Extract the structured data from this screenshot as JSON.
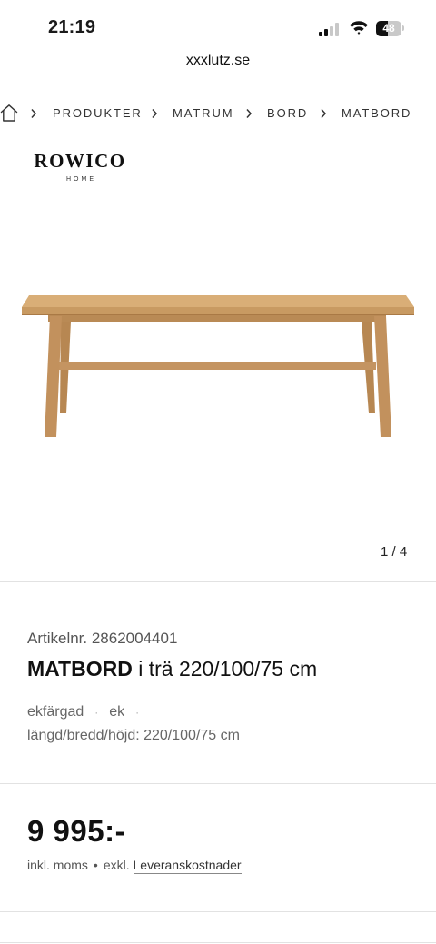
{
  "status_bar": {
    "time": "21:19",
    "battery": "48",
    "battery_level": 0.48
  },
  "browser": {
    "url": "xxxlutz.se"
  },
  "breadcrumb": {
    "home_icon": "home-icon",
    "items": [
      "PRODUKTER",
      "MATRUM",
      "BORD",
      "MATBORD"
    ]
  },
  "brand": {
    "name": "ROWICO",
    "sub": "HOME"
  },
  "gallery": {
    "counter": "1 / 4",
    "current": 1,
    "total": 4
  },
  "product": {
    "sku": "Artikelnr. 2862004401",
    "title_bold": "MATBORD",
    "title_rest": " i trä 220/100/75 cm",
    "attributes": [
      "ekfärgad",
      "ek"
    ],
    "dimensions": "längd/bredd/höjd: 220/100/75 cm"
  },
  "price": {
    "value": "9 995:-",
    "incl": "inkl. moms",
    "bullet": "•",
    "excl": "exkl.",
    "shipping_link": "Leveranskostnader"
  },
  "colors": {
    "wood": "#c89a62",
    "divider": "#e2e2e2",
    "text": "#1a1a1a"
  }
}
